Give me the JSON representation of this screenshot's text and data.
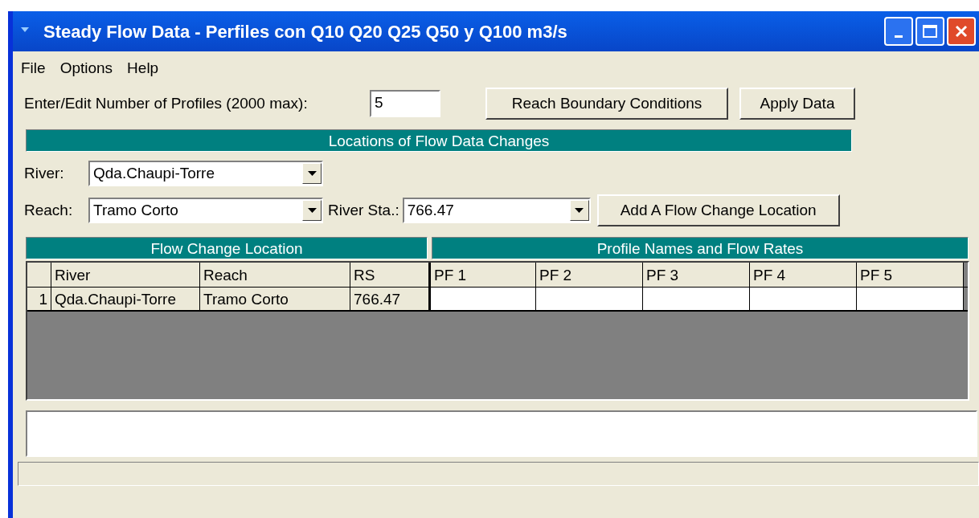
{
  "window": {
    "title": "Steady Flow Data - Perfiles con Q10 Q20 Q25 Q50 y Q100 m3/s"
  },
  "menu": [
    "File",
    "Options",
    "Help"
  ],
  "profiles": {
    "label": "Enter/Edit Number of Profiles (2000 max):",
    "value": "5"
  },
  "top_buttons": [
    "Reach Boundary Conditions",
    "Apply Data"
  ],
  "locations_title": "Locations of Flow Data Changes",
  "river": {
    "label": "River:",
    "value": "Qda.Chaupi-Torre"
  },
  "reach": {
    "label": "Reach:",
    "value": "Tramo Corto"
  },
  "river_sta": {
    "label": "River Sta.:",
    "value": "766.47"
  },
  "add_button": "Add A Flow Change Location",
  "table": {
    "groups": [
      "Flow Change Location",
      "Profile Names and Flow Rates"
    ],
    "columns": [
      "River",
      "Reach",
      "RS",
      "PF 1",
      "PF 2",
      "PF 3",
      "PF 4",
      "PF 5"
    ],
    "rows": [
      {
        "number": "1",
        "cells": [
          "Qda.Chaupi-Torre",
          "Tramo Corto",
          "766.47"
        ]
      }
    ]
  }
}
